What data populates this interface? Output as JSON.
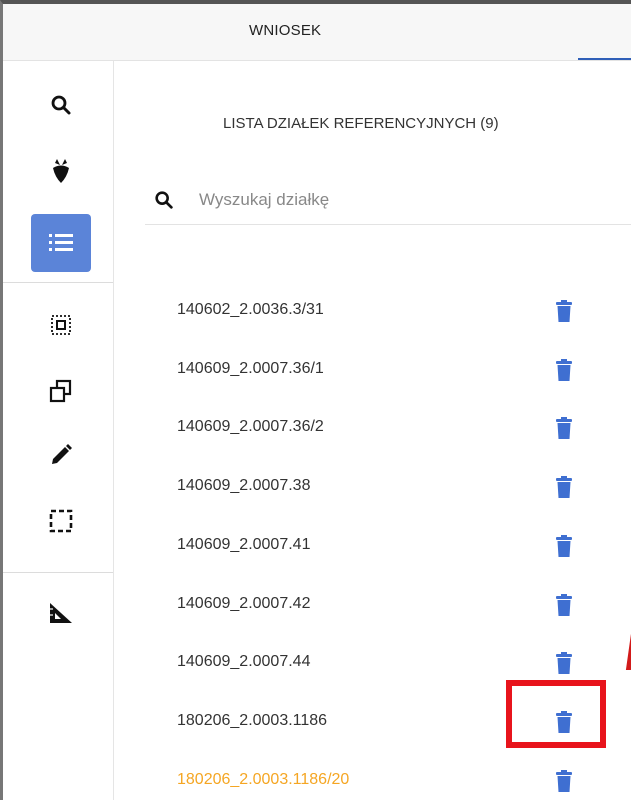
{
  "header": {
    "tab_label": "WNIOSEK"
  },
  "sidebar": {
    "items": [
      {
        "name": "search-icon",
        "label": "search"
      },
      {
        "name": "beet-icon",
        "label": "crop"
      },
      {
        "name": "list-icon",
        "label": "list",
        "active": true
      },
      {
        "name": "select-area-icon",
        "label": "select"
      },
      {
        "name": "copy-icon",
        "label": "copy"
      },
      {
        "name": "pencil-icon",
        "label": "edit"
      },
      {
        "name": "crop-frame-icon",
        "label": "frame"
      },
      {
        "name": "ruler-triangle-icon",
        "label": "measure"
      }
    ]
  },
  "main": {
    "title": "LISTA DZIAŁEK REFERENCYJNYCH (9)",
    "search": {
      "placeholder": "Wyszukaj działkę",
      "value": ""
    },
    "parcels": [
      {
        "id": "140602_2.0036.3/31"
      },
      {
        "id": "140609_2.0007.36/1"
      },
      {
        "id": "140609_2.0007.36/2"
      },
      {
        "id": "140609_2.0007.38"
      },
      {
        "id": "140609_2.0007.41"
      },
      {
        "id": "140609_2.0007.42"
      },
      {
        "id": "140609_2.0007.44"
      },
      {
        "id": "180206_2.0003.1186"
      },
      {
        "id": "180206_2.0003.1186/20",
        "highlighted": true
      }
    ]
  },
  "colors": {
    "accent": "#5b84d8",
    "trash": "#3f6fd1",
    "highlight_text": "#f5a623",
    "annotation": "#e8141c"
  }
}
